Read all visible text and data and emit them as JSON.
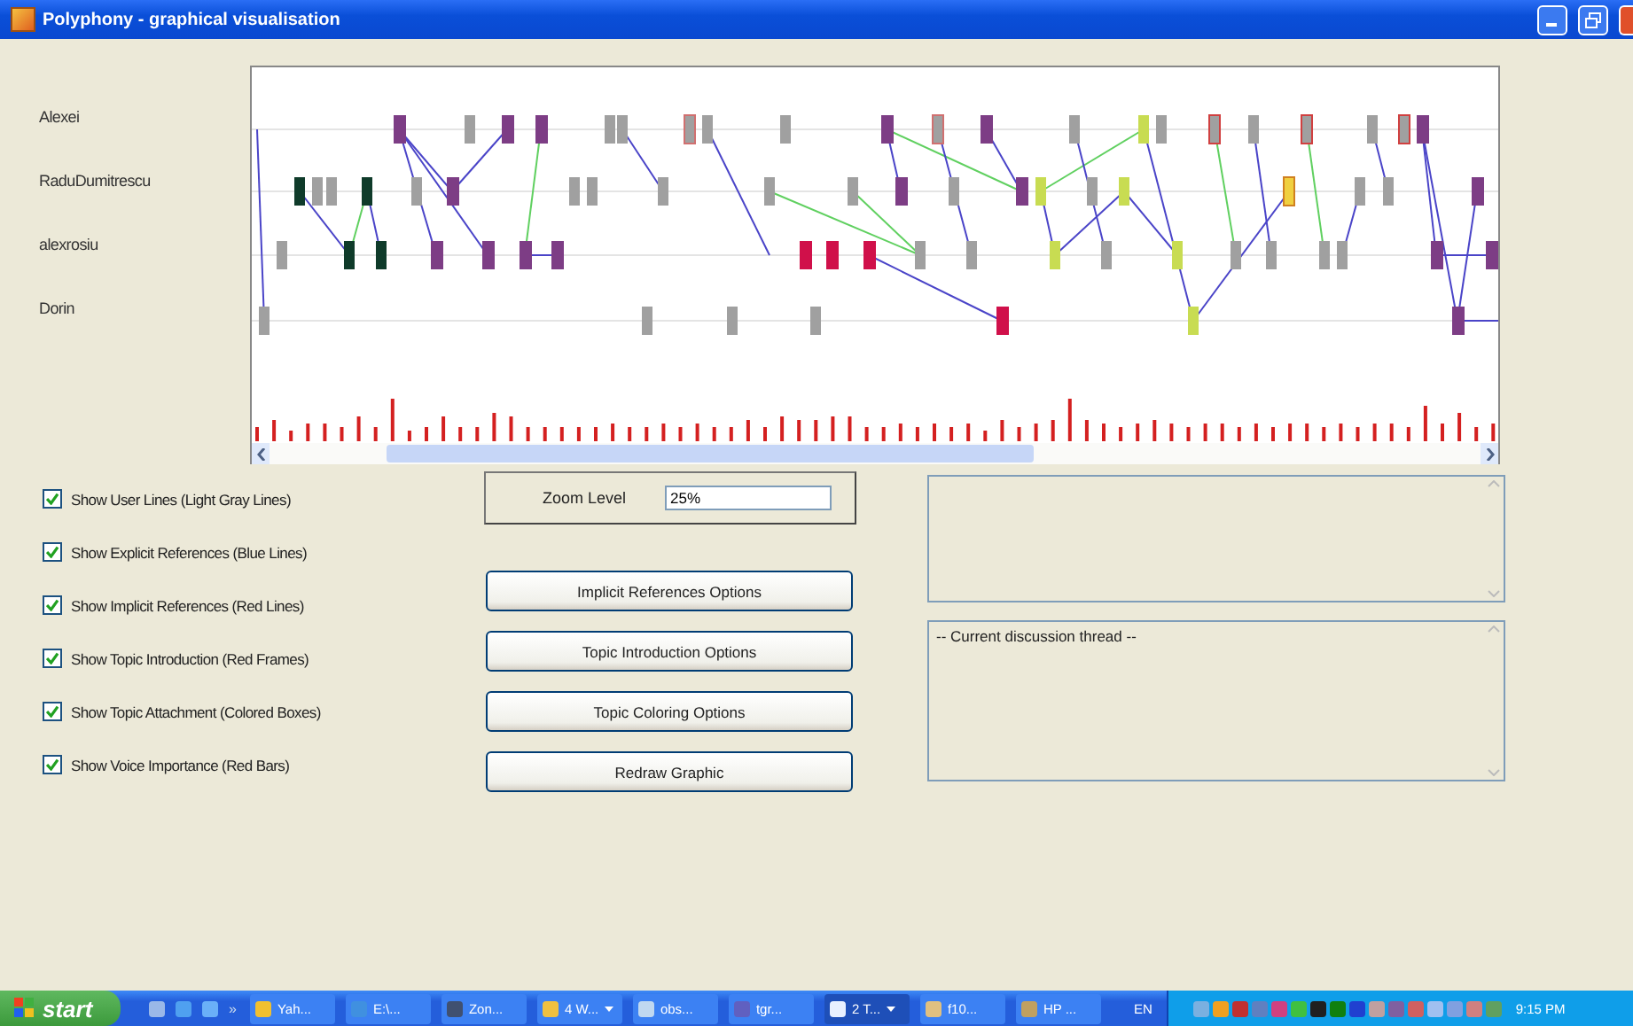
{
  "window": {
    "title": "Polyphony - graphical visualisation"
  },
  "users": [
    {
      "name": "Alexei"
    },
    {
      "name": "RaduDumitrescu"
    },
    {
      "name": "alexrosiu"
    },
    {
      "name": "Dorin"
    }
  ],
  "options": [
    {
      "label": "Show User Lines (Light Gray Lines)",
      "checked": true
    },
    {
      "label": "Show Explicit References (Blue Lines)",
      "checked": true
    },
    {
      "label": "Show Implicit References (Red Lines)",
      "checked": true
    },
    {
      "label": "Show Topic Introduction (Red Frames)",
      "checked": true
    },
    {
      "label": "Show Topic Attachment (Colored Boxes)",
      "checked": true
    },
    {
      "label": "Show Voice Importance (Red Bars)",
      "checked": true
    }
  ],
  "zoom": {
    "label": "Zoom Level",
    "value": "25%"
  },
  "buttons": [
    "Implicit References Options",
    "Topic Introduction Options",
    "Topic Coloring Options",
    "Redraw Graphic"
  ],
  "thread_box": {
    "value": "-- Current discussion thread --"
  },
  "taskbar": {
    "start": "start",
    "more": "»",
    "tasks": [
      {
        "label": "Yah...",
        "selected": false,
        "grouped": false
      },
      {
        "label": "E:\\...",
        "selected": false,
        "grouped": false
      },
      {
        "label": "Zon...",
        "selected": false,
        "grouped": false
      },
      {
        "label": "4 W...",
        "selected": false,
        "grouped": true
      },
      {
        "label": "obs...",
        "selected": false,
        "grouped": false
      },
      {
        "label": "tgr...",
        "selected": false,
        "grouped": false
      },
      {
        "label": "2 T...",
        "selected": true,
        "grouped": true
      },
      {
        "label": "f10...",
        "selected": false,
        "grouped": false
      },
      {
        "label": "HP ...",
        "selected": false,
        "grouped": false
      }
    ],
    "language": "EN",
    "clock": "9:15 PM"
  }
}
